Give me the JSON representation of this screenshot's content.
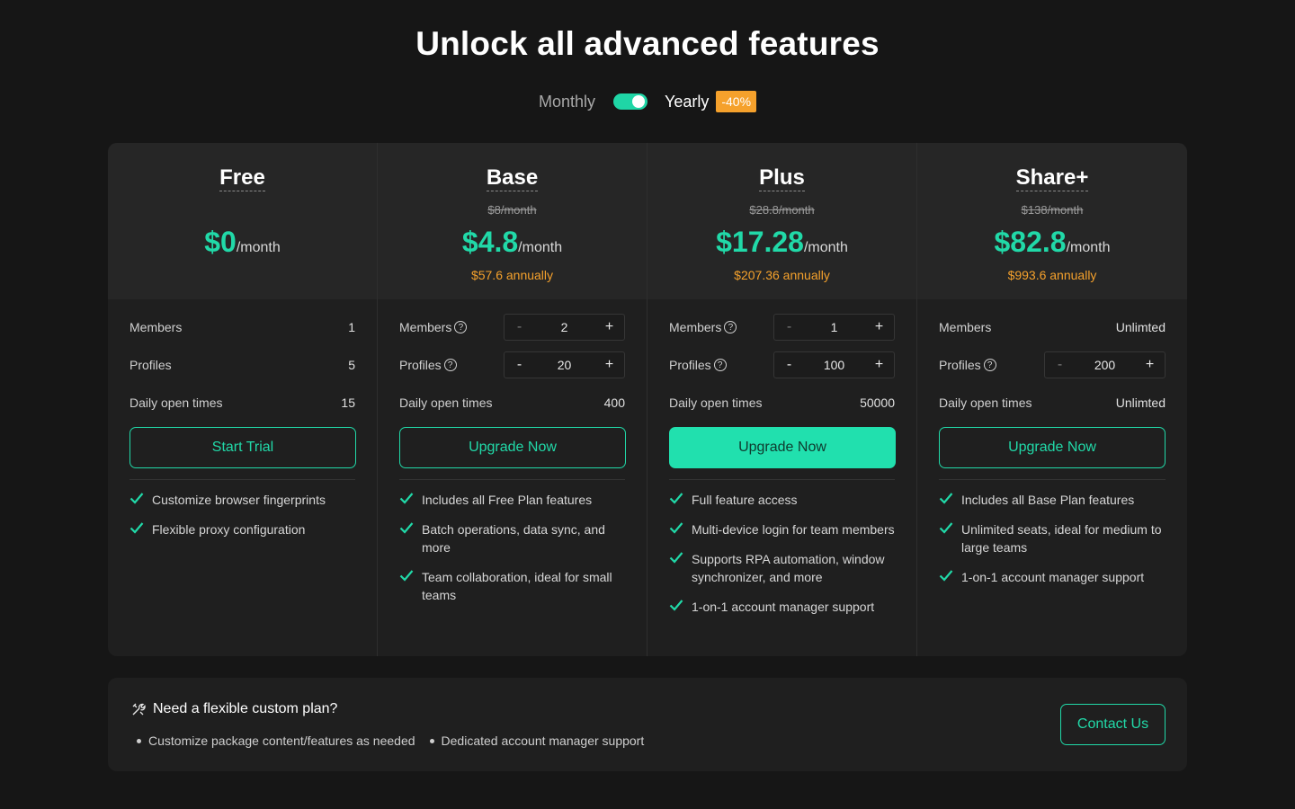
{
  "header": {
    "title": "Unlock all advanced features"
  },
  "billing": {
    "monthly_label": "Monthly",
    "yearly_label": "Yearly",
    "discount_badge": "-40%",
    "yearly_selected": true
  },
  "colors": {
    "accent": "#21d9a8",
    "orange": "#f5a12c",
    "background": "#161616",
    "card": "#1f1f1f"
  },
  "plans": [
    {
      "name": "Free",
      "old_price": "",
      "price": "$0",
      "per": "/month",
      "annual": "",
      "members": {
        "label": "Members",
        "value": "1"
      },
      "profiles": {
        "label": "Profiles",
        "value": "5"
      },
      "daily": {
        "label": "Daily open times",
        "value": "15"
      },
      "cta": "Start Trial",
      "features": [
        "Customize browser fingerprints",
        "Flexible proxy configuration"
      ]
    },
    {
      "name": "Base",
      "old_price": "$8/month",
      "price": "$4.8",
      "per": "/month",
      "annual": "$57.6 annually",
      "members": {
        "label": "Members",
        "value": "2",
        "minus": "-",
        "plus": "+"
      },
      "profiles": {
        "label": "Profiles",
        "value": "20",
        "minus": "-",
        "plus": "+"
      },
      "daily": {
        "label": "Daily open times",
        "value": "400"
      },
      "cta": "Upgrade Now",
      "features": [
        "Includes all Free Plan features",
        "Batch operations, data sync, and more",
        "Team collaboration, ideal for small teams"
      ]
    },
    {
      "name": "Plus",
      "old_price": "$28.8/month",
      "price": "$17.28",
      "per": "/month",
      "annual": "$207.36 annually",
      "members": {
        "label": "Members",
        "value": "1",
        "minus": "-",
        "plus": "+"
      },
      "profiles": {
        "label": "Profiles",
        "value": "100",
        "minus": "-",
        "plus": "+"
      },
      "daily": {
        "label": "Daily open times",
        "value": "50000"
      },
      "cta": "Upgrade Now",
      "features": [
        "Full feature access",
        "Multi-device login for team members",
        "Supports RPA automation, window synchronizer, and more",
        "1-on-1 account manager support"
      ]
    },
    {
      "name": "Share+",
      "old_price": "$138/month",
      "price": "$82.8",
      "per": "/month",
      "annual": "$993.6 annually",
      "members": {
        "label": "Members",
        "value": "Unlimted"
      },
      "profiles": {
        "label": "Profiles",
        "value": "200",
        "minus": "-",
        "plus": "+"
      },
      "daily": {
        "label": "Daily open times",
        "value": "Unlimted"
      },
      "cta": "Upgrade Now",
      "features": [
        "Includes all Base Plan features",
        "Unlimited seats, ideal for medium to large teams",
        "1-on-1 account manager support"
      ]
    }
  ],
  "custom": {
    "title": "Need a flexible custom plan?",
    "points": [
      "Customize package content/features as needed",
      "Dedicated account manager support"
    ],
    "cta": "Contact Us"
  }
}
